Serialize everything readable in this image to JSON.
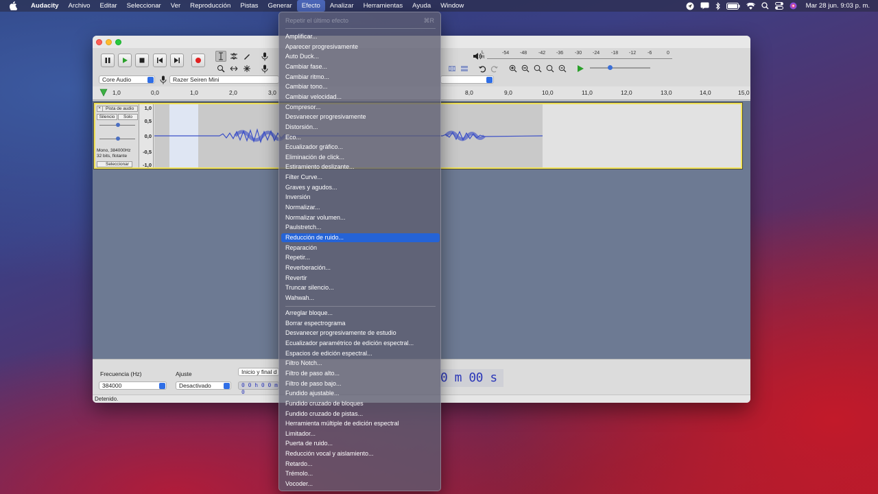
{
  "menubar": {
    "app_name": "Audacity",
    "items": [
      "Archivo",
      "Editar",
      "Seleccionar",
      "Ver",
      "Reproducción",
      "Pistas",
      "Generar",
      "Efecto",
      "Analizar",
      "Herramientas",
      "Ayuda",
      "Window"
    ],
    "open_item": "Efecto",
    "clock": "Mar 28 jun.  9:03 p. m."
  },
  "toolbar": {
    "host": "Core Audio",
    "input_device": "Razer Seiren Mini",
    "meter_ticks": [
      "-54",
      "-48",
      "-42",
      "-36",
      "-30",
      "-24",
      "-18",
      "-12",
      "-6",
      "0"
    ],
    "meter_lr_a": "L",
    "meter_lr_b": "R"
  },
  "ruler": {
    "ticks": [
      "1,0",
      "0,0",
      "1,0",
      "2,0",
      "3,0",
      "8,0",
      "9,0",
      "10,0",
      "11,0",
      "12,0",
      "13,0",
      "14,0",
      "15,0"
    ]
  },
  "track": {
    "name": "Pista de audio",
    "close": "×",
    "mute": "Silencio",
    "solo": "Solo",
    "info_line1": "Mono, 384000Hz",
    "info_line2": "32 bits, flotante",
    "select": "Seleccionar",
    "scale": [
      "1,0",
      "0,5",
      "0,0",
      "-0,5",
      "-1,0"
    ]
  },
  "selection_bar": {
    "rate_label": "Frecuencia (Hz)",
    "rate_value": "384000",
    "snap_label": "Ajuste",
    "snap_value": "Desactivado",
    "range_label": "Inicio y final d",
    "time_value": "0 0 h 0 0 m 0",
    "big_time": "0 m 00 s"
  },
  "status": "Detenido.",
  "effect_menu": {
    "repeat_last": "Repetir el último efecto",
    "repeat_shortcut": "⌘R",
    "group1": [
      "Amplificar...",
      "Aparecer progresivamente",
      "Auto Duck...",
      "Cambiar fase...",
      "Cambiar ritmo...",
      "Cambiar tono...",
      "Cambiar velocidad...",
      "Compresor...",
      "Desvanecer progresivamente",
      "Distorsión...",
      "Eco...",
      "Ecualizador gráfico...",
      "Eliminación de click...",
      "Estiramiento deslizante...",
      "Filter Curve...",
      "Graves y agudos...",
      "Inversión",
      "Normalizar...",
      "Normalizar volumen...",
      "Paulstretch...",
      "Reducción de ruido...",
      "Reparación",
      "Repetir...",
      "Reverberación...",
      "Revertir",
      "Truncar silencio...",
      "Wahwah..."
    ],
    "highlighted": "Reducción de ruido...",
    "group2": [
      "Arreglar bloque...",
      "Borrar espectrograma",
      "Desvanecer progresivamente de estudio",
      "Ecualizador paramétrico de edición espectral...",
      "Espacios de edición espectral...",
      "Filtro Notch...",
      "Filtro de paso alto...",
      "Filtro de paso bajo...",
      "Fundido ajustable...",
      "Fundido cruzado de bloques",
      "Fundido cruzado de pistas...",
      "Herramienta múltiple de edición espectral",
      "Limitador...",
      "Puerta de ruido...",
      "Reducción vocal y aislamiento...",
      "Retardo...",
      "Trémolo...",
      "Vocoder..."
    ]
  }
}
